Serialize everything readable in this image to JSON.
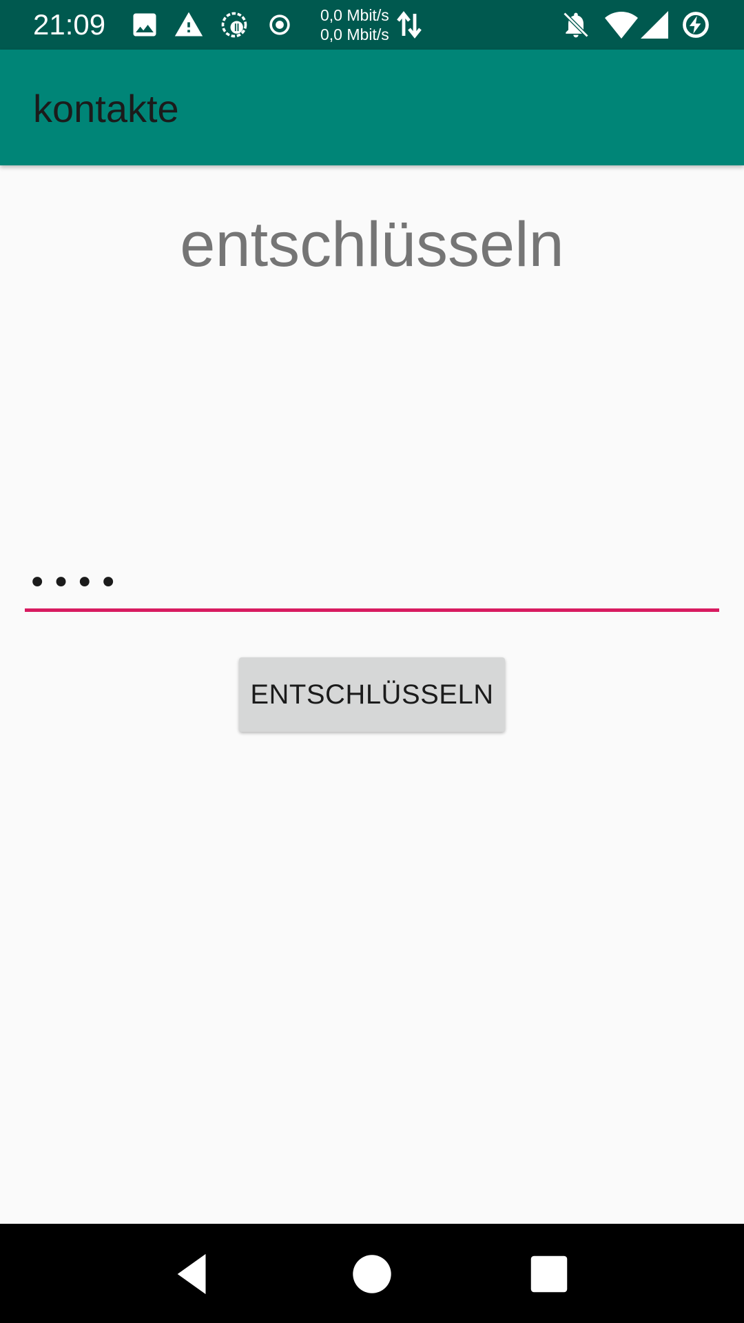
{
  "status_bar": {
    "time": "21:09",
    "net_speed_up": "0,0 Mbit/s",
    "net_speed_down": "0,0 Mbit/s",
    "icons": [
      "image-icon",
      "warning-icon",
      "data-saver-icon",
      "radio-button-icon",
      "data-transfer-icon",
      "notifications-off-icon",
      "wifi-icon",
      "signal-icon",
      "battery-charging-icon"
    ],
    "background_color": "#00594f"
  },
  "app_bar": {
    "title": "kontakte",
    "background_color": "#008577"
  },
  "main": {
    "heading": "entschlüsseln",
    "password_field": {
      "value": "1234",
      "accent_color": "#d81b60"
    },
    "decrypt_button_label": "ENTSCHLÜSSELN"
  },
  "nav_bar": {
    "buttons": [
      "back-icon",
      "home-icon",
      "recents-icon"
    ]
  }
}
